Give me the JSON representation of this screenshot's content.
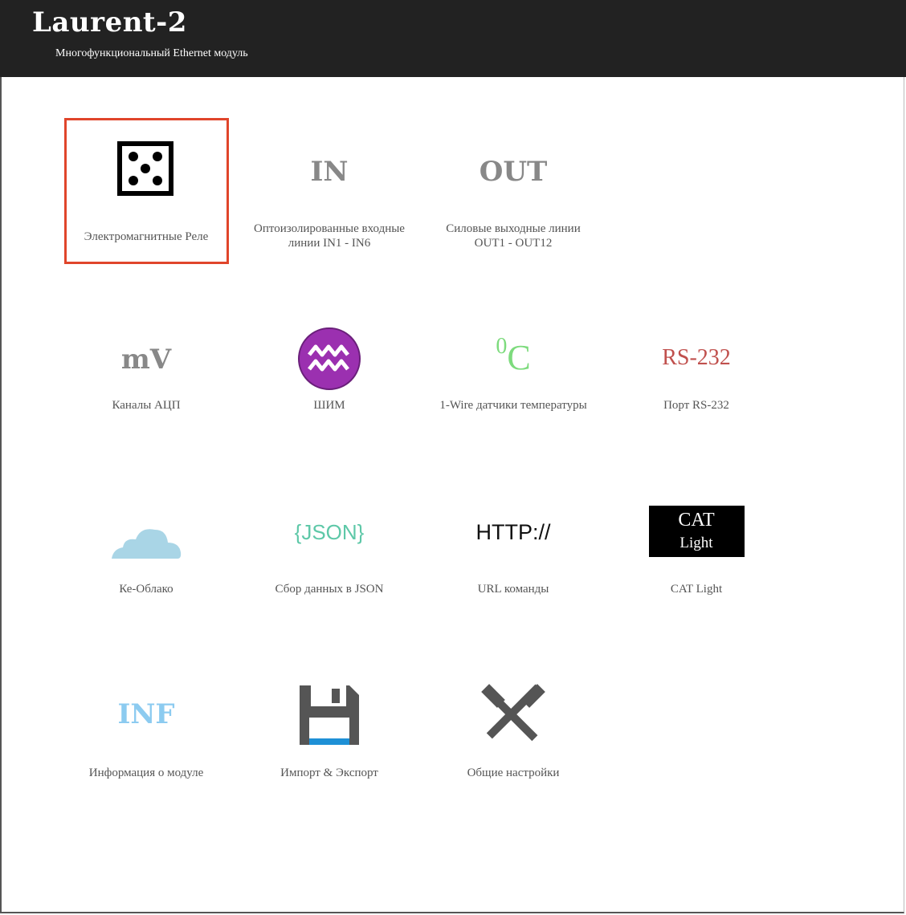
{
  "header": {
    "title": "Laurent-2",
    "subtitle": "Многофункциональный Ethernet модуль"
  },
  "tiles": {
    "relay": {
      "label": "Электромагнитные Реле",
      "icon": "dice-icon"
    },
    "inputs": {
      "glyph": "IN",
      "label_line1": "Оптоизолированные входные",
      "label_line2": "линии IN1 - IN6"
    },
    "outputs": {
      "glyph": "OUT",
      "label_line1": "Силовые выходные линии",
      "label_line2": "OUT1 - OUT12"
    },
    "adc": {
      "glyph": "mV",
      "label": "Каналы АЦП"
    },
    "pwm": {
      "label": "ШИМ",
      "icon": "aquarius-icon"
    },
    "temp": {
      "glyph_sup": "0",
      "glyph": "C",
      "label": "1-Wire датчики температуры"
    },
    "rs232": {
      "glyph": "RS-232",
      "label": "Порт RS-232"
    },
    "cloud": {
      "label": "Ке-Облако",
      "icon": "cloud-icon"
    },
    "json": {
      "glyph": "{JSON}",
      "label": "Сбор данных в JSON"
    },
    "http": {
      "glyph": "HTTP://",
      "label": "URL команды"
    },
    "cat": {
      "glyph_line1": "CAT",
      "glyph_line2": "Light",
      "label": "CAT Light"
    },
    "info": {
      "glyph": "INF",
      "label": "Информация о модуле"
    },
    "importexport": {
      "label": "Импорт & Экспорт",
      "icon": "floppy-disk-icon"
    },
    "settings": {
      "label": "Общие настройки",
      "icon": "hammers-icon"
    }
  },
  "colors": {
    "header_bg": "#222222",
    "selection": "#e0452b",
    "gray_glyph": "#888888",
    "temp_green": "#7ddb7d",
    "rs232_red": "#c0504d",
    "json_teal": "#5ec8a8",
    "cloud_blue": "#a9d5e6",
    "info_blue": "#8ccbf0",
    "pwm_purple": "#9b30b0"
  }
}
